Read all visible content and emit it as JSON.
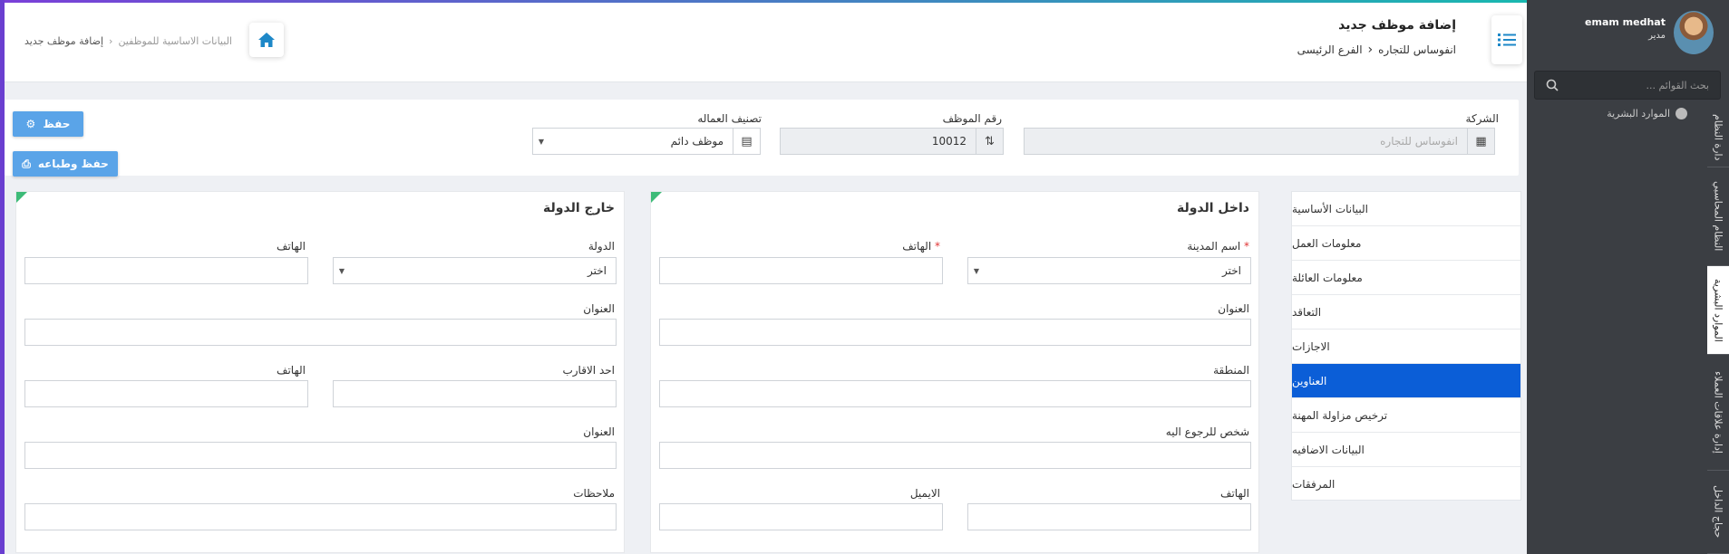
{
  "header": {
    "title": "إضافة موظف جديد",
    "company": "انفوساس للتجاره",
    "branch": "الفرع الرئيسى"
  },
  "breadcrumb": {
    "parent": "البيانات الاساسية للموظفين",
    "current": "إضافة موظف جديد"
  },
  "user": {
    "name": "emam medhat",
    "role": "مدير"
  },
  "sidebar": {
    "search_placeholder": "بحث القوائم ...",
    "module": "الموارد البشرية",
    "vertical_tabs": [
      "دارة النظام",
      "النظام المحاسبي",
      "الموارد البشرية",
      "إدارة علاقات العملاء",
      "حجاج الداخل"
    ]
  },
  "form": {
    "company_label": "الشركة",
    "company_placeholder": "انفوساس للتجاره",
    "employee_no_label": "رقم الموظف",
    "employee_no_value": "10012",
    "employment_type_label": "تصنيف العماله",
    "employment_type_value": "موظف دائم"
  },
  "actions": {
    "save": "حفظ",
    "save_print": "حفظ وطباعه"
  },
  "nav": {
    "items": [
      "البيانات الأساسية",
      "معلومات العمل",
      "معلومات العائلة",
      "التعاقد",
      "الاجازات",
      "العناوين",
      "ترخيص مزاولة المهنة",
      "البيانات الاضافيه",
      "المرفقات"
    ],
    "active_index": 5
  },
  "inside": {
    "title": "داخل الدولة",
    "city_label": "اسم المدينة",
    "city_value": "اختر",
    "phone_label": "الهاتف",
    "address_label": "العنوان",
    "area_label": "المنطقة",
    "contact_label": "شخص للرجوع اليه",
    "phone2_label": "الهاتف",
    "email_label": "الايميل",
    "required_mark": "*"
  },
  "outside": {
    "title": "خارج الدولة",
    "country_label": "الدولة",
    "country_value": "اختر",
    "phone_label": "الهاتف",
    "address_label": "العنوان",
    "relative_label": "احد الاقارب",
    "relative_phone_label": "الهاتف",
    "relative_address_label": "العنوان",
    "notes_label": "ملاحظات"
  },
  "colors": {
    "accent": "#0b5ed7",
    "button": "#5aa4e8",
    "sidebar": "#3b3e43",
    "corner": "#3dbb78"
  },
  "icons": {
    "menu": "list-icon",
    "home": "home-icon",
    "search": "search-icon",
    "building": "building-icon",
    "sort": "sort-icon",
    "card": "id-card-icon",
    "gear": "gear-icon",
    "print": "print-icon"
  }
}
